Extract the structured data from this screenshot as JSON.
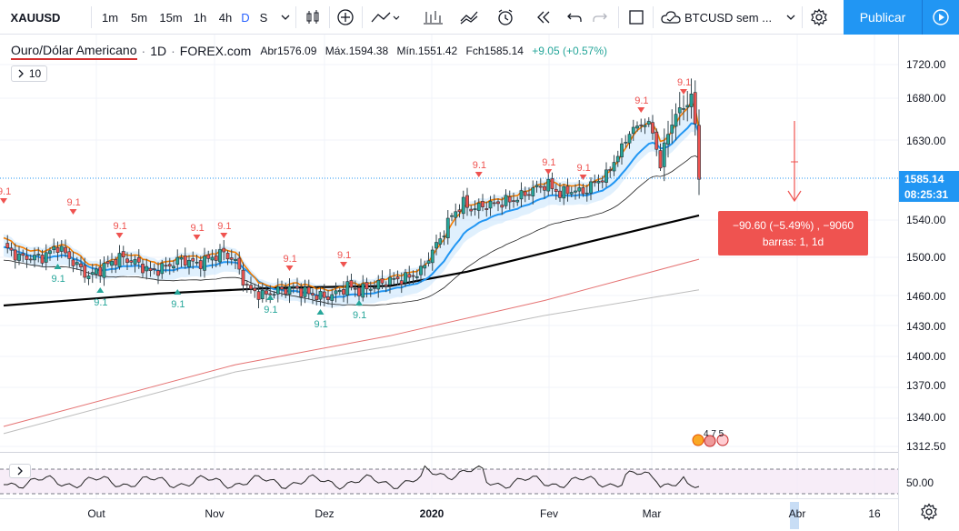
{
  "toolbar": {
    "symbol": "XAUUSD",
    "intervals": [
      "1m",
      "5m",
      "15m",
      "1h",
      "4h",
      "D",
      "S"
    ],
    "active_interval": "D",
    "compare_search": "BTCUSD sem ...",
    "publish_label": "Publicar",
    "icons": [
      "plus-circle-icon",
      "indicators-icon",
      "chart-type-icon",
      "alert-icon",
      "replay-icon",
      "undo-icon",
      "redo-icon",
      "layout-icon",
      "cloud-icon",
      "settings-icon",
      "play-icon"
    ]
  },
  "legend": {
    "title": "Ouro/Dólar Americano",
    "sep1": "·",
    "interval": "1D",
    "sep2": "·",
    "source": "FOREX.com",
    "open": "Abr1576.09",
    "high": "Máx.1594.38",
    "low": "Mín.1551.42",
    "close": "Fch1585.14",
    "change": "+9.05 (+0.57%)",
    "indicators_count": "10"
  },
  "price_axis": {
    "ticks": [
      "1720.00",
      "1680.00",
      "1630.00",
      "1540.00",
      "1500.00",
      "1460.00",
      "1430.00",
      "1400.00",
      "1370.00",
      "1340.00",
      "1312.50"
    ],
    "last_price": "1585.14",
    "countdown": "08:25:31",
    "rsi_tick": "50.00"
  },
  "time_axis": {
    "ticks": [
      "Out",
      "Nov",
      "Dez",
      "2020",
      "Fev",
      "Mar",
      "Abr",
      "16"
    ]
  },
  "measure": {
    "line1": "−90.60 (−5.49%) , −9060",
    "line2": "barras: 1, 1d"
  },
  "signals": {
    "label": "9.1",
    "events_badge": "4 7 5"
  },
  "colors": {
    "up": "#26a69a",
    "down": "#ef5350",
    "ema_fast": "#f57c00",
    "ema_mid": "#2196f3",
    "ma_long": "#000000",
    "ma_red": "#e91e63",
    "ma_gray": "#9e9e9e",
    "band_fill": "#bbdefb",
    "price_label": "#2196f3",
    "accent": "#2196f3"
  },
  "chart_data": {
    "type": "candlestick",
    "title": "Ouro/Dólar Americano",
    "interval": "1D",
    "ylim": [
      1312.5,
      1730
    ],
    "y_ticks": [
      1312.5,
      1340,
      1370,
      1400,
      1430,
      1460,
      1500,
      1540,
      1585,
      1630,
      1680,
      1720
    ],
    "last_close": 1585.14,
    "key_points": [
      {
        "x": "Sep",
        "y": 1505
      },
      {
        "x": "Out",
        "y": 1500
      },
      {
        "x": "Nov",
        "y": 1475
      },
      {
        "x": "Dez",
        "y": 1465
      },
      {
        "x": "2020",
        "y": 1545
      },
      {
        "x": "Fev",
        "y": 1580
      },
      {
        "x": "Mar",
        "y": 1650
      },
      {
        "x": "Mar (peak)",
        "y": 1700
      },
      {
        "x": "Mar (last)",
        "y": 1585
      }
    ],
    "rsi": {
      "level": 50.0,
      "bands": [
        30,
        70
      ]
    }
  }
}
